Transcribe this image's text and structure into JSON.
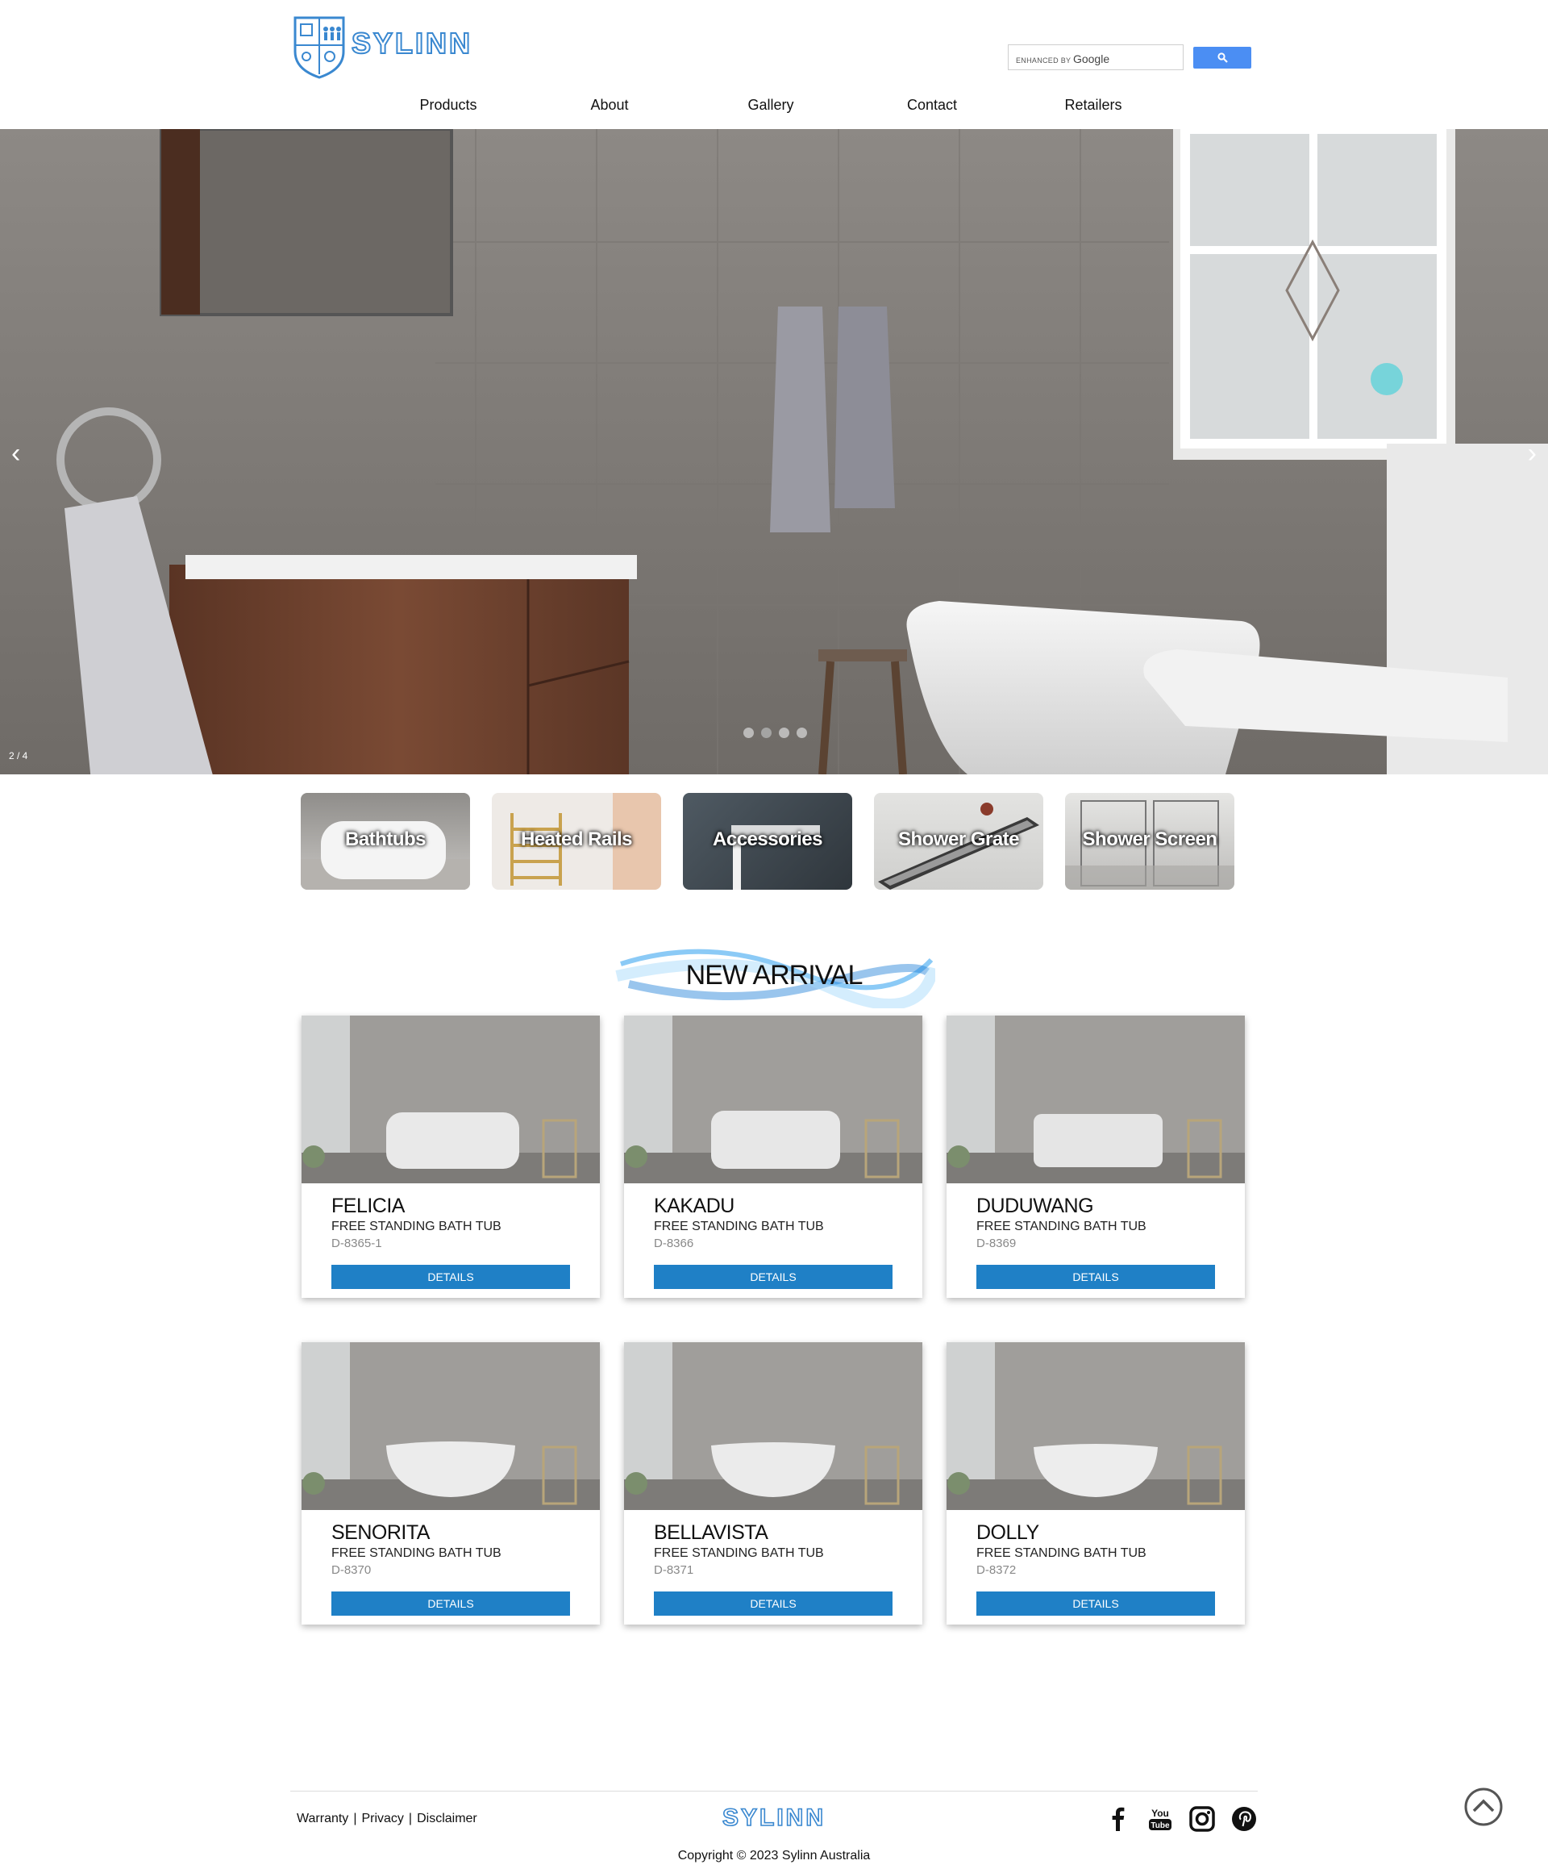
{
  "brand": {
    "name": "SYLINN",
    "color": "#3a88d0"
  },
  "search": {
    "brand_prefix": "ENHANCED BY",
    "brand_name": "Google",
    "button_icon": "search-icon",
    "button_color": "#4b8ef3"
  },
  "nav": {
    "items": [
      "Products",
      "About",
      "Gallery",
      "Contact",
      "Retailers"
    ]
  },
  "hero": {
    "slide_counter": "2 / 4",
    "prev": "‹",
    "next": "›",
    "slide_count": 4
  },
  "categories": [
    "Bathtubs",
    "Heated Rails",
    "Accessories",
    "Shower Grate",
    "Shower Screen"
  ],
  "new_arrival": {
    "title": "NEW ARRIVAL",
    "products": [
      {
        "name": "FELICIA",
        "type": "FREE STANDING BATH TUB",
        "code": "D-8365-1",
        "button": "DETAILS"
      },
      {
        "name": "KAKADU",
        "type": "FREE STANDING BATH TUB",
        "code": "D-8366",
        "button": "DETAILS"
      },
      {
        "name": "DUDUWANG",
        "type": "FREE STANDING BATH TUB",
        "code": "D-8369",
        "button": "DETAILS"
      },
      {
        "name": "SENORITA",
        "type": "FREE STANDING BATH TUB",
        "code": "D-8370",
        "button": "DETAILS"
      },
      {
        "name": "BELLAVISTA",
        "type": "FREE STANDING BATH TUB",
        "code": "D-8371",
        "button": "DETAILS"
      },
      {
        "name": "DOLLY",
        "type": "FREE STANDING BATH TUB",
        "code": "D-8372",
        "button": "DETAILS"
      }
    ]
  },
  "footer": {
    "links": [
      "Warranty",
      "Privacy",
      "Disclaimer"
    ],
    "separator": "|",
    "social": [
      "facebook-icon",
      "youtube-icon",
      "instagram-icon",
      "pinterest-icon"
    ],
    "youtube_text": [
      "You",
      "Tube"
    ],
    "copyright": "Copyright © 2023 Sylinn Australia"
  }
}
